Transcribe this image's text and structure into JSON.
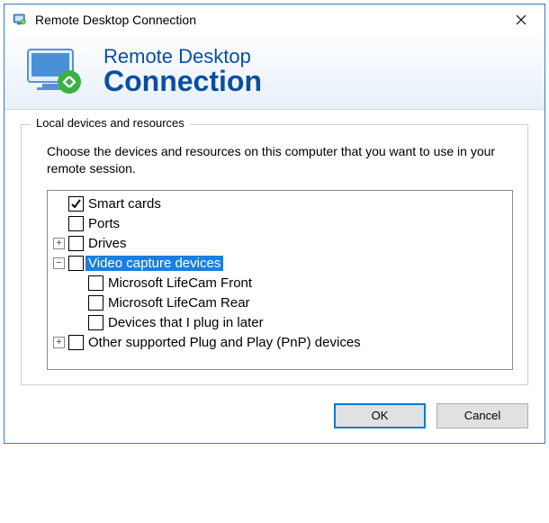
{
  "titlebar": {
    "title": "Remote Desktop Connection"
  },
  "banner": {
    "line1": "Remote Desktop",
    "line2": "Connection"
  },
  "group": {
    "legend": "Local devices and resources",
    "instruction": "Choose the devices and resources on this computer that you want to use in your remote session."
  },
  "tree": {
    "smart_cards": "Smart cards",
    "ports": "Ports",
    "drives": "Drives",
    "video_capture": "Video capture devices",
    "lifecam_front": "Microsoft LifeCam Front",
    "lifecam_rear": "Microsoft LifeCam Rear",
    "plug_later": "Devices that I plug in later",
    "other_pnp": "Other supported Plug and Play (PnP) devices"
  },
  "buttons": {
    "ok": "OK",
    "cancel": "Cancel"
  }
}
